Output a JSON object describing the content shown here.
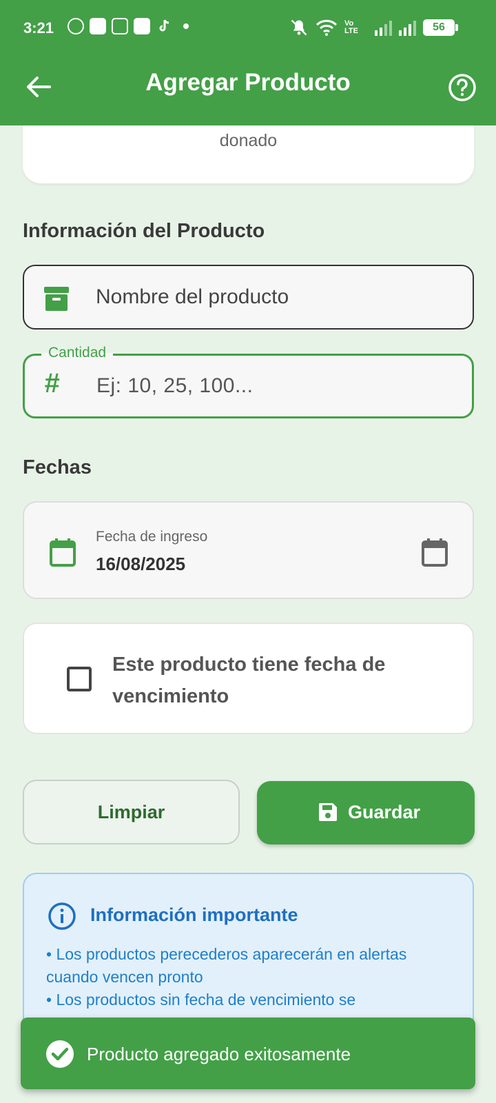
{
  "status_bar": {
    "time": "3:21",
    "battery": "56",
    "volte": "Vo LTE"
  },
  "app_bar": {
    "title": "Agregar Producto",
    "back_icon": "arrow-back-icon",
    "help_icon": "help-circle-icon"
  },
  "donor_card": {
    "text": "donado"
  },
  "product_section": {
    "title": "Información del Producto",
    "name_field": {
      "placeholder": "Nombre del producto",
      "icon": "archive-box-icon"
    },
    "quantity_field": {
      "label": "Cantidad",
      "placeholder": "Ej: 10, 25, 100...",
      "icon": "hash-icon"
    }
  },
  "dates_section": {
    "title": "Fechas",
    "entry_date": {
      "label": "Fecha de ingreso",
      "value": "16/08/2025"
    },
    "expiry_checkbox": {
      "label": "Este producto tiene fecha de vencimiento",
      "checked": false
    }
  },
  "actions": {
    "clear_label": "Limpiar",
    "save_label": "Guardar"
  },
  "info": {
    "title": "Información importante",
    "line1": "• Los productos perecederos aparecerán en alertas cuando vencen pronto",
    "line2": "• Los productos sin fecha de vencimiento se"
  },
  "snackbar": {
    "message": "Producto agregado exitosamente"
  },
  "colors": {
    "primary": "#43a047",
    "background": "#e8f3e8",
    "info_blue": "#1e6fc0"
  }
}
